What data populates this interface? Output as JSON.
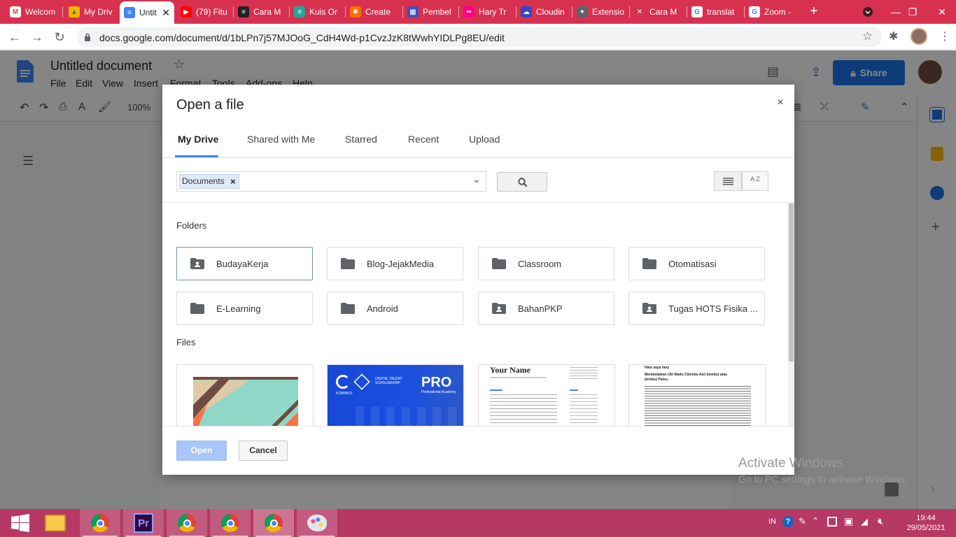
{
  "browser": {
    "tabs": [
      {
        "title": "Welcom",
        "fav_color": "#ffffff",
        "fav_text": "M",
        "fav_text_color": "#ea4335"
      },
      {
        "title": "My Driv",
        "fav_color": "#f4b400",
        "fav_text": "▲",
        "fav_text_color": "#0f9d58"
      },
      {
        "title": "Untit",
        "fav_color": "#4285f4",
        "fav_text": "≡",
        "fav_text_color": "#ffffff"
      },
      {
        "title": "(79) Fitu",
        "fav_color": "#ff0000",
        "fav_text": "▶",
        "fav_text_color": "#ffffff"
      },
      {
        "title": "Cara M",
        "fav_color": "#202124",
        "fav_text": "≡",
        "fav_text_color": "#ffffff"
      },
      {
        "title": "Kuis Or",
        "fav_color": "#26a69a",
        "fav_text": "≡",
        "fav_text_color": "#ffffff"
      },
      {
        "title": "Create",
        "fav_color": "#ff6d00",
        "fav_text": "✺",
        "fav_text_color": "#ffffff"
      },
      {
        "title": "Pembel",
        "fav_color": "#3f51b5",
        "fav_text": "▦",
        "fav_text_color": "#ffffff"
      },
      {
        "title": "Hary Tr",
        "fav_color": "#ff0084",
        "fav_text": "••",
        "fav_text_color": "#ffffff"
      },
      {
        "title": "Cloudin",
        "fav_color": "#3448c5",
        "fav_text": "☁",
        "fav_text_color": "#ffffff"
      },
      {
        "title": "Extensio",
        "fav_color": "#5f6368",
        "fav_text": "✦",
        "fav_text_color": "#ffffff"
      },
      {
        "title": "Cara M",
        "fav_color": "#d7314f",
        "fav_text": "✕",
        "fav_text_color": "#ffffff"
      },
      {
        "title": "translat",
        "fav_color": "#ffffff",
        "fav_text": "G",
        "fav_text_color": "#4285f4"
      },
      {
        "title": "Zoom -",
        "fav_color": "#ffffff",
        "fav_text": "G",
        "fav_text_color": "#4285f4"
      }
    ],
    "new_tab": "+",
    "url": "docs.google.com/document/d/1bLPn7j57MJOoG_CdH4Wd-p1CvzJzK8tWwhYIDLPg8EU/edit",
    "tab_strip_color": "#d7314f"
  },
  "docs": {
    "title": "Untitled document",
    "menus": [
      "File",
      "Edit",
      "View",
      "Insert",
      "Format",
      "Tools",
      "Add-ons",
      "Help"
    ],
    "share_label": "Share",
    "zoom": "100%"
  },
  "dialog": {
    "title": "Open a file",
    "close": "×",
    "tabs": [
      "My Drive",
      "Shared with Me",
      "Starred",
      "Recent",
      "Upload"
    ],
    "active_tab": "My Drive",
    "filter_chip": "Documents",
    "chip_remove": "×",
    "sort_label": "A Z",
    "folders_heading": "Folders",
    "folders": [
      {
        "name": "BudayaKerja",
        "shared": true,
        "selected": true
      },
      {
        "name": "Blog-JejakMedia",
        "shared": false,
        "selected": false
      },
      {
        "name": "Classroom",
        "shared": false,
        "selected": false
      },
      {
        "name": "Otomatisasi",
        "shared": false,
        "selected": false
      },
      {
        "name": "E-Learning",
        "shared": false,
        "selected": false
      },
      {
        "name": "Android",
        "shared": false,
        "selected": false
      },
      {
        "name": "BahanPKP",
        "shared": true,
        "selected": false
      },
      {
        "name": "Tugas HOTS Fisika ...",
        "shared": true,
        "selected": false
      }
    ],
    "files_heading": "Files",
    "files": [
      {
        "kind": "geometric"
      },
      {
        "kind": "banner",
        "brand": "KOMINFO",
        "program": "DIGITAL TALENT SCHOLARSHIP",
        "badge": "PRO",
        "badge_sub": "Professional Academy"
      },
      {
        "kind": "resume",
        "heading": "Your Name"
      },
      {
        "kind": "article",
        "line1": "Halo saya hary",
        "line2": "Membedakan Ubi Madu Cilembu Asli (lembu) atau (lembu) Palsu."
      }
    ],
    "open_label": "Open",
    "cancel_label": "Cancel"
  },
  "windows": {
    "activate_line1": "Activate Windows",
    "activate_line2": "Go to PC settings to activate Windows.",
    "language": "IN",
    "time": "19:44",
    "date": "29/05/2021",
    "premiere_label": "Pr"
  }
}
